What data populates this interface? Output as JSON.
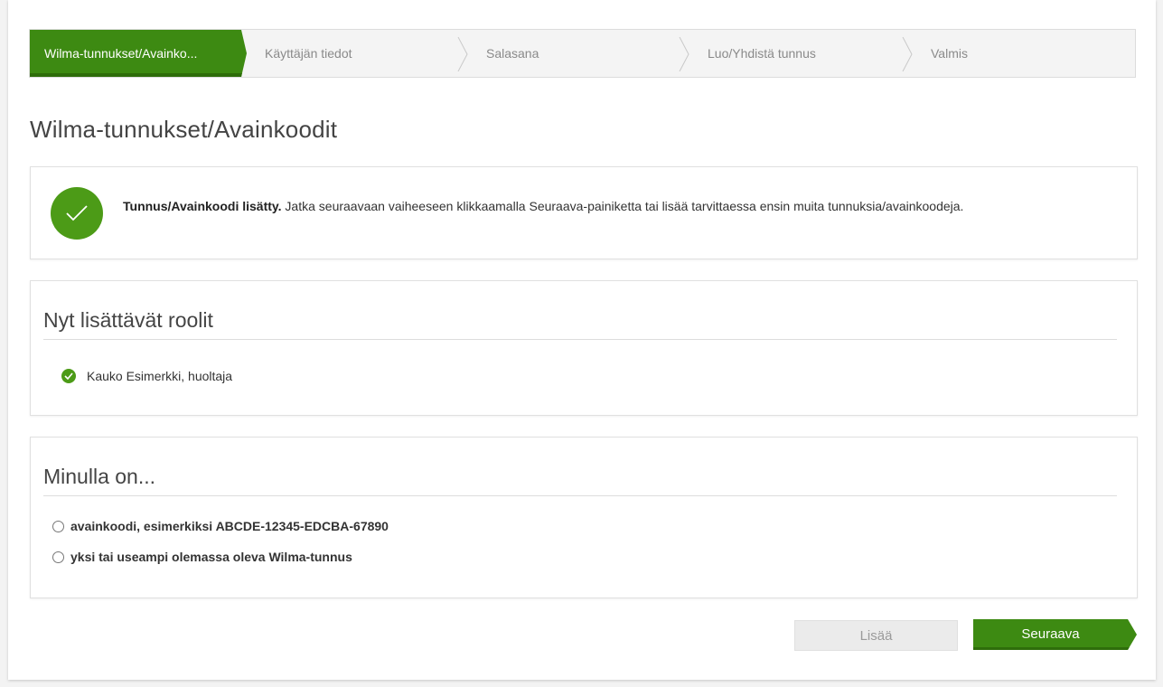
{
  "stepper": {
    "steps": [
      {
        "label": "Wilma-tunnukset/Avainko...",
        "active": true
      },
      {
        "label": "Käyttäjän tiedot",
        "active": false
      },
      {
        "label": "Salasana",
        "active": false
      },
      {
        "label": "Luo/Yhdistä tunnus",
        "active": false
      },
      {
        "label": "Valmis",
        "active": false
      }
    ]
  },
  "page": {
    "title": "Wilma-tunnukset/Avainkoodit"
  },
  "alert": {
    "icon": "check-icon",
    "bold": "Tunnus/Avainkoodi lisätty.",
    "text": " Jatka seuraavaan vaiheeseen klikkaamalla Seuraava-painiketta tai lisää tarvittaessa ensin muita tunnuksia/avainkoodeja."
  },
  "roles": {
    "heading": "Nyt lisättävät roolit",
    "items": [
      {
        "label": "Kauko Esimerkki, huoltaja",
        "icon": "check-circle-icon"
      }
    ]
  },
  "have": {
    "heading": "Minulla on...",
    "options": [
      {
        "label": "avainkoodi, esimerkiksi ABCDE-12345-EDCBA-67890",
        "selected": false
      },
      {
        "label": "yksi tai useampi olemassa oleva Wilma-tunnus",
        "selected": false
      }
    ]
  },
  "buttons": {
    "add_label": "Lisää",
    "next_label": "Seuraava"
  },
  "colors": {
    "accent": "#3d8a12",
    "success": "#4c9b17",
    "disabled_bg": "#ebebeb"
  }
}
